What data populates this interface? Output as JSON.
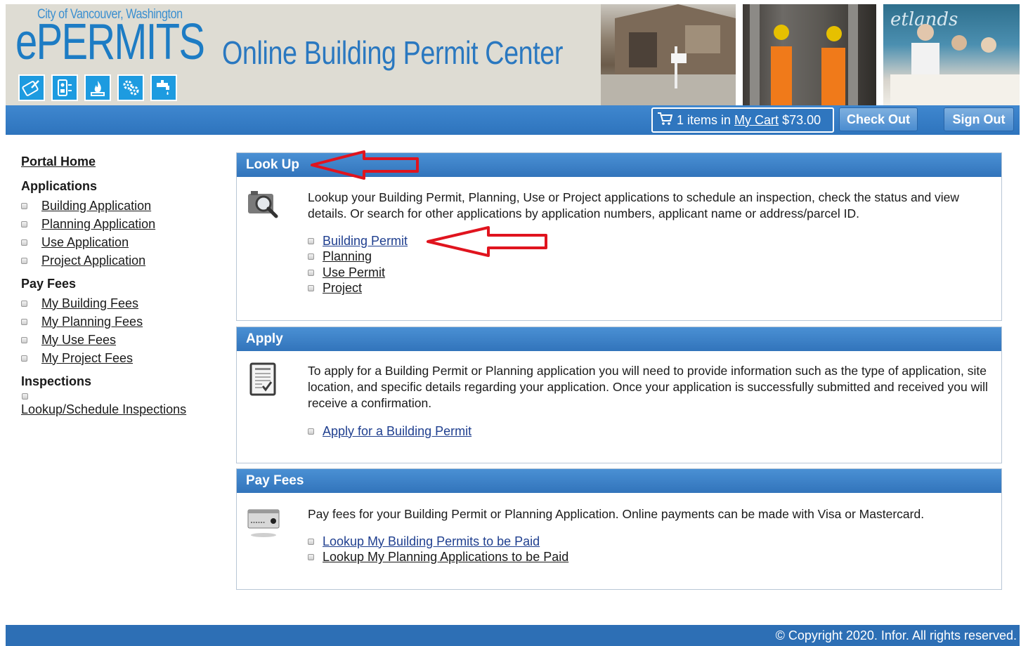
{
  "header": {
    "city": "City of Vancouver, Washington",
    "brand": "ePERMITS",
    "site_title": "Online Building Permit Center",
    "icons": [
      "permit-pen-icon",
      "electrical-meter-icon",
      "fire-flame-icon",
      "gears-icon",
      "water-faucet-icon"
    ]
  },
  "nav": {
    "cart_count_text": "1 items in",
    "cart_link": "My Cart",
    "cart_total": "$73.00",
    "checkout_label": "Check Out",
    "signout_label": "Sign Out"
  },
  "sidebar": {
    "portal_home": "Portal Home",
    "applications_heading": "Applications",
    "applications": [
      "Building Application",
      "Planning Application",
      "Use Application",
      "Project Application"
    ],
    "fees_heading": "Pay Fees",
    "fees": [
      "My Building Fees",
      "My Planning Fees",
      "My Use Fees",
      "My Project Fees"
    ],
    "inspections_heading": "Inspections",
    "inspections_link": "Lookup/Schedule Inspections"
  },
  "lookup": {
    "title": "Look Up",
    "description": "Lookup your Building Permit, Planning, Use or Project applications to schedule an inspection, check the status and view details. Or search for other applications by application numbers, applicant name or address/parcel ID.",
    "links": [
      "Building Permit",
      "Planning",
      "Use Permit",
      "Project"
    ]
  },
  "apply": {
    "title": "Apply",
    "description": "To apply for a Building Permit or Planning application you will need to provide information such as the type of application, site location, and specific details regarding your application. Once your application is successfully submitted and received you will receive a confirmation.",
    "link": "Apply for a Building Permit"
  },
  "fees": {
    "title": "Pay Fees",
    "description": "Pay fees for your Building Permit or Planning Application. Online payments can be made with Visa or Mastercard.",
    "links": [
      "Lookup My Building Permits to be Paid",
      "Lookup My Planning Applications to be Paid"
    ]
  },
  "footer": {
    "copyright": "© Copyright 2020. Infor. All rights reserved."
  },
  "colors": {
    "brand_blue": "#1d7cc4",
    "nav_blue": "#2e74bd",
    "header_bg": "#dedcd3",
    "annotation_red": "#e0141e"
  }
}
